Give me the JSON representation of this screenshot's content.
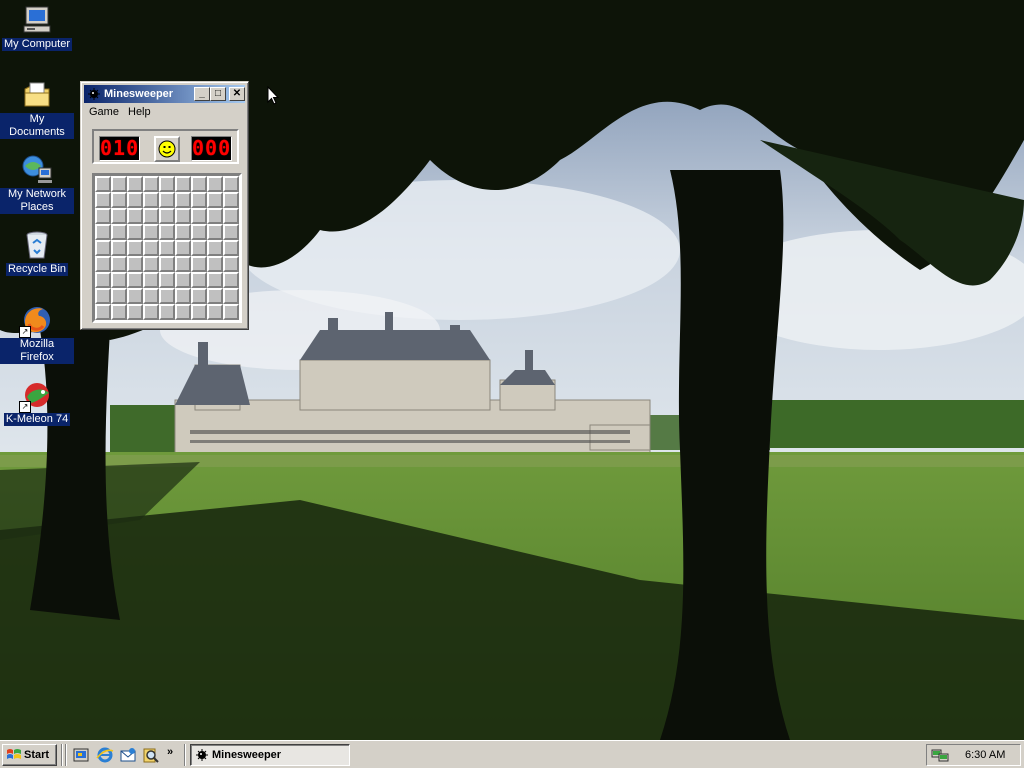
{
  "desktop": {
    "icons": [
      {
        "label": "My Computer",
        "icon": "my-computer-icon"
      },
      {
        "label": "My Documents",
        "icon": "my-documents-icon"
      },
      {
        "label": "My Network Places",
        "icon": "network-places-icon"
      },
      {
        "label": "Recycle Bin",
        "icon": "recycle-bin-icon"
      },
      {
        "label": "Mozilla Firefox",
        "icon": "firefox-icon"
      },
      {
        "label": "K-Meleon 74",
        "icon": "k-meleon-icon"
      }
    ]
  },
  "minesweeper": {
    "title": "Minesweeper",
    "menu": [
      "Game",
      "Help"
    ],
    "mine_counter": "010",
    "timer": "000",
    "face": "smiley-face-icon",
    "grid": {
      "rows": 9,
      "cols": 9,
      "state": "all-covered"
    }
  },
  "taskbar": {
    "start_label": "Start",
    "quicklaunch": [
      "show-desktop-icon",
      "internet-explorer-icon",
      "outlook-express-icon",
      "search-icon"
    ],
    "quicklaunch_more": "»",
    "tasks": [
      {
        "label": "Minesweeper",
        "active": true
      }
    ],
    "clock": "6:30 AM"
  },
  "colors": {
    "selection": "#0a246a",
    "title_gradient_start": "#0a246a",
    "title_gradient_end": "#a6caf0",
    "chrome": "#d4d0c8",
    "led": "#ff0000"
  }
}
